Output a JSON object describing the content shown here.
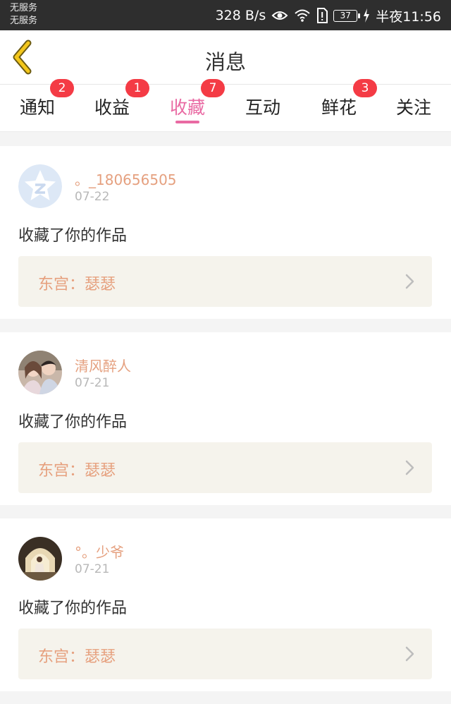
{
  "status_bar": {
    "carrier_1": "无服务",
    "carrier_2": "无服务",
    "net_speed": "328 B/s",
    "battery": "37",
    "time": "半夜11:56"
  },
  "header": {
    "title": "消息"
  },
  "tabs": [
    {
      "label": "通知",
      "badge": "2"
    },
    {
      "label": "收益",
      "badge": "1"
    },
    {
      "label": "收藏",
      "badge": "7",
      "active": true
    },
    {
      "label": "互动",
      "badge": ""
    },
    {
      "label": "鲜花",
      "badge": "3"
    },
    {
      "label": "关注",
      "badge": ""
    }
  ],
  "messages": [
    {
      "username": "。_180656505",
      "date": "07-22",
      "action": "收藏了你的作品",
      "work": "东宫：瑟瑟"
    },
    {
      "username": "清风醉人",
      "date": "07-21",
      "action": "收藏了你的作品",
      "work": "东宫：瑟瑟"
    },
    {
      "username": "°。少爷",
      "date": "07-21",
      "action": "收藏了你的作品",
      "work": "东宫：瑟瑟"
    }
  ],
  "colors": {
    "accent_pink": "#e96aa3",
    "badge_red": "#f43b45",
    "username_orange": "#e5a07f",
    "back_arrow_yellow": "#f3c61b"
  }
}
